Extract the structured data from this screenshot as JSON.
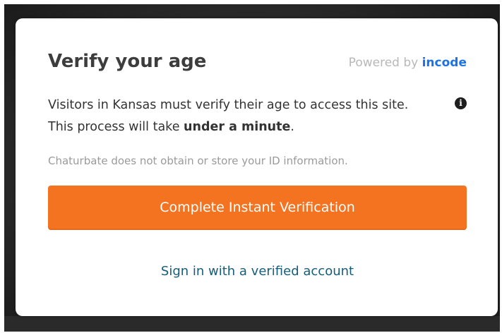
{
  "modal": {
    "title": "Verify your age",
    "powered_by_prefix": "Powered by",
    "powered_by_brand": "incode",
    "description_line1": "Visitors in Kansas must verify their age to access this site.",
    "description_line2_prefix": "This process will take",
    "description_line2_bold": "under a minute",
    "description_line2_suffix": ".",
    "info_icon": "info-circle-icon",
    "privacy_note": "Chaturbate does not obtain or store your ID information.",
    "primary_button_label": "Complete Instant Verification",
    "secondary_link_label": "Sign in with a verified account"
  },
  "colors": {
    "primary_button": "#f47321",
    "link": "#165d7a",
    "brand": "#1a73e8",
    "title": "#3d3d3d"
  }
}
